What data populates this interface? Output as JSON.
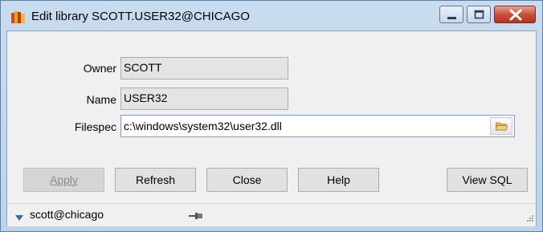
{
  "window": {
    "title": "Edit library SCOTT.USER32@CHICAGO",
    "app_icon": "library-books-icon"
  },
  "caption_buttons": {
    "minimize_icon": "minimize-icon",
    "maximize_icon": "maximize-icon",
    "close_icon": "close-icon"
  },
  "form": {
    "owner_label": "Owner",
    "owner_value": "SCOTT",
    "name_label": "Name",
    "name_value": "USER32",
    "filespec_label": "Filespec",
    "filespec_value": "c:\\windows\\system32\\user32.dll",
    "browse_icon": "folder-open-icon"
  },
  "buttons": {
    "apply": "Apply",
    "refresh": "Refresh",
    "close": "Close",
    "help": "Help",
    "view_sql": "View SQL"
  },
  "status": {
    "connection": "scott@chicago",
    "pin_icon": "pin-icon",
    "grip_icon": "resize-grip-icon"
  }
}
